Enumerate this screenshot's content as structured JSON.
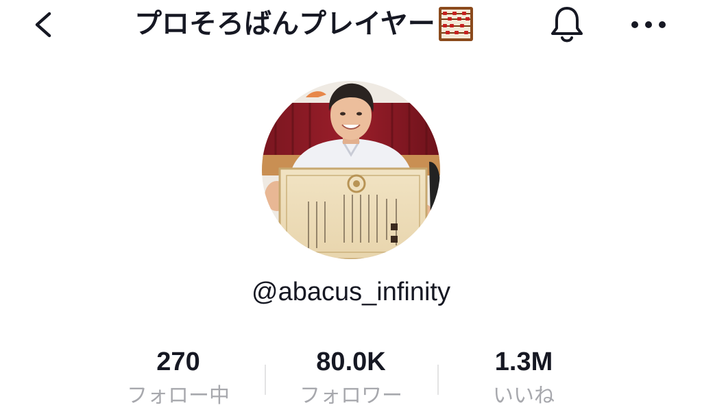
{
  "header": {
    "title": "プロそろばんプレイヤー",
    "title_emoji": "abacus-emoji",
    "back_icon": "chevron-left-icon",
    "notification_icon": "bell-icon",
    "more_icon": "more-horizontal-icon"
  },
  "profile": {
    "handle": "@abacus_infinity",
    "avatar": "avatar-photo"
  },
  "stats": [
    {
      "value": "270",
      "label": "フォロー中"
    },
    {
      "value": "80.0K",
      "label": "フォロワー"
    },
    {
      "value": "1.3M",
      "label": "いいね"
    }
  ],
  "colors": {
    "text_primary": "#161823",
    "text_secondary": "#a7a8ad",
    "divider": "#e3e3e4",
    "background": "#ffffff"
  }
}
